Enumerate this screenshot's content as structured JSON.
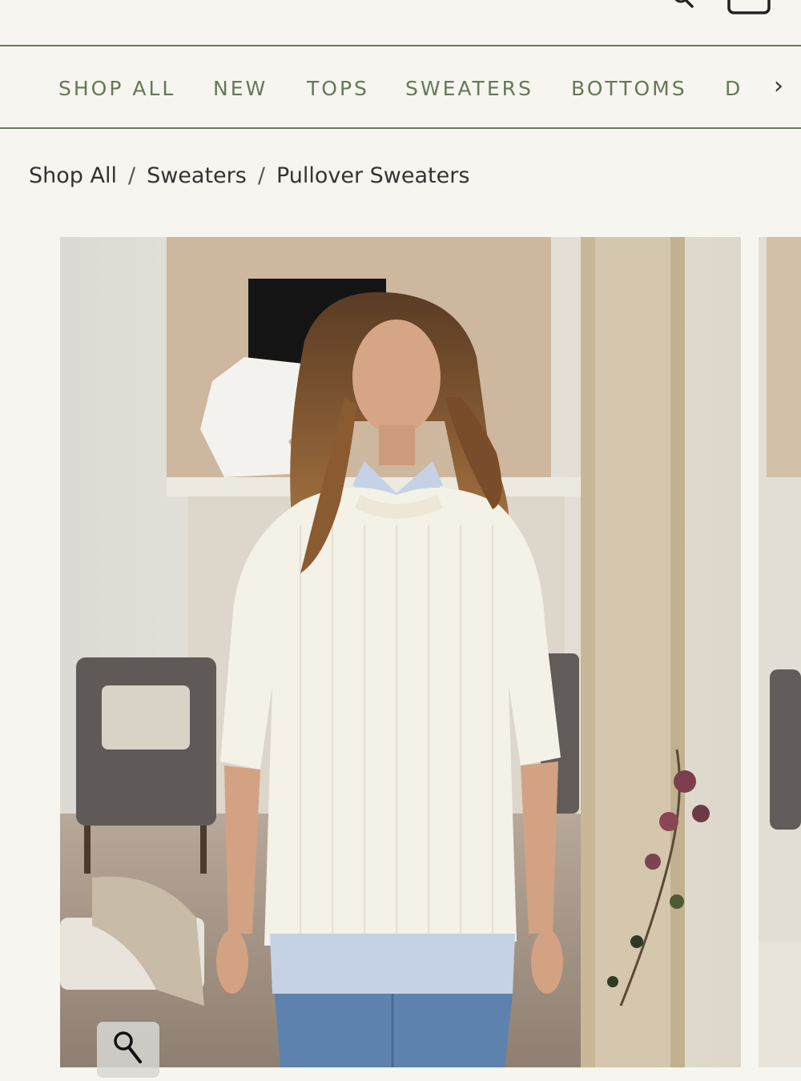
{
  "header": {
    "icons": [
      "search-icon",
      "bag-icon"
    ]
  },
  "nav": {
    "items": [
      {
        "label": "SHOP ALL"
      },
      {
        "label": "NEW"
      },
      {
        "label": "TOPS"
      },
      {
        "label": "SWEATERS"
      },
      {
        "label": "BOTTOMS"
      },
      {
        "label": "D"
      }
    ],
    "next_arrow": "›"
  },
  "breadcrumb": {
    "items": [
      "Shop All",
      "Sweaters",
      "Pullover Sweaters"
    ],
    "separator": "/"
  },
  "gallery": {
    "zoom_icon": "magnifier-icon"
  },
  "colors": {
    "background": "#f6f5ef",
    "nav_text": "#66775a",
    "rule": "#6b7b5a",
    "sweater": "#f4f1e6",
    "shirt": "#c5d2e6",
    "jeans": "#5d82ad"
  }
}
